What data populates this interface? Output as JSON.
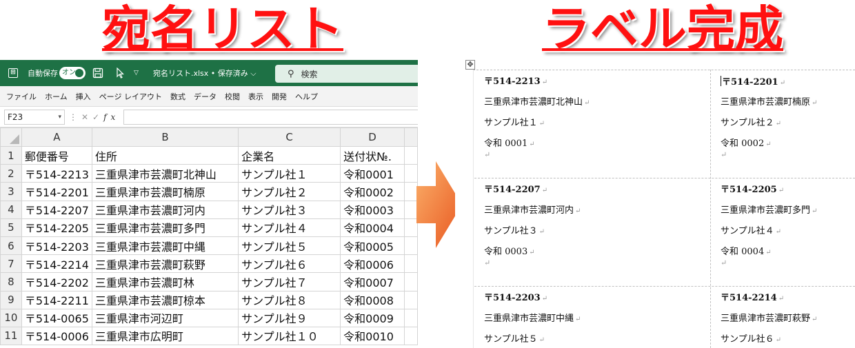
{
  "titles": {
    "left": "宛名リスト",
    "right": "ラベル完成"
  },
  "excel": {
    "autosave_label": "自動保存",
    "toggle_label": "オン",
    "filename": "宛名リスト.xlsx • 保存済み ⌵",
    "search_placeholder": "検索",
    "menu": [
      "ファイル",
      "ホーム",
      "挿入",
      "ページ レイアウト",
      "数式",
      "データ",
      "校閲",
      "表示",
      "開発",
      "ヘルプ"
    ],
    "name_box": "F23",
    "columns": [
      "A",
      "B",
      "C",
      "D"
    ],
    "rows": [
      {
        "n": "1",
        "cells": [
          "郵便番号",
          "住所",
          "企業名",
          "送付状№."
        ]
      },
      {
        "n": "2",
        "cells": [
          "〒514-2213",
          "三重県津市芸濃町北神山",
          "サンプル社１",
          "令和0001"
        ]
      },
      {
        "n": "3",
        "cells": [
          "〒514-2201",
          "三重県津市芸濃町楠原",
          "サンプル社２",
          "令和0002"
        ]
      },
      {
        "n": "4",
        "cells": [
          "〒514-2207",
          "三重県津市芸濃町河内",
          "サンプル社３",
          "令和0003"
        ]
      },
      {
        "n": "5",
        "cells": [
          "〒514-2205",
          "三重県津市芸濃町多門",
          "サンプル社４",
          "令和0004"
        ]
      },
      {
        "n": "6",
        "cells": [
          "〒514-2203",
          "三重県津市芸濃町中縄",
          "サンプル社５",
          "令和0005"
        ]
      },
      {
        "n": "7",
        "cells": [
          "〒514-2214",
          "三重県津市芸濃町萩野",
          "サンプル社６",
          "令和0006"
        ]
      },
      {
        "n": "8",
        "cells": [
          "〒514-2202",
          "三重県津市芸濃町林",
          "サンプル社７",
          "令和0007"
        ]
      },
      {
        "n": "9",
        "cells": [
          "〒514-2211",
          "三重県津市芸濃町椋本",
          "サンプル社８",
          "令和0008"
        ]
      },
      {
        "n": "10",
        "cells": [
          "〒514-0065",
          "三重県津市河辺町",
          "サンプル社９",
          "令和0009"
        ]
      },
      {
        "n": "11",
        "cells": [
          "〒514-0006",
          "三重県津市広明町",
          "サンプル社１０",
          "令和0010"
        ]
      }
    ]
  },
  "labels": [
    {
      "zip": "〒514-2213",
      "address": "三重県津市芸濃町北神山",
      "company": "サンプル社１",
      "no": "令和 0001"
    },
    {
      "zip": "〒514-2201",
      "address": "三重県津市芸濃町楠原",
      "company": "サンプル社２",
      "no": "令和 0002"
    },
    {
      "zip": "〒514-2207",
      "address": "三重県津市芸濃町河内",
      "company": "サンプル社３",
      "no": "令和 0003"
    },
    {
      "zip": "〒514-2205",
      "address": "三重県津市芸濃町多門",
      "company": "サンプル社４",
      "no": "令和 0004"
    },
    {
      "zip": "〒514-2203",
      "address": "三重県津市芸濃町中縄",
      "company": "サンプル社５"
    },
    {
      "zip": "〒514-2214",
      "address": "三重県津市芸濃町萩野",
      "company": "サンプル社６"
    }
  ],
  "colors": {
    "excel_green": "#1e7145",
    "title_red": "#ff1111",
    "arrow_light": "#fbb06a",
    "arrow_dark": "#e8561f"
  }
}
